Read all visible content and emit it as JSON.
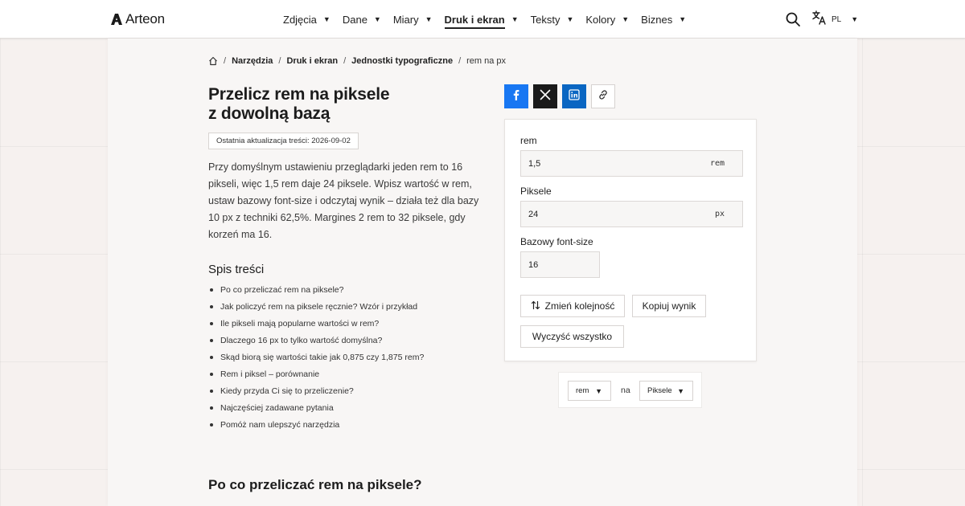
{
  "header": {
    "logo_text": "Arteon",
    "nav": [
      {
        "label": "Zdjęcia",
        "active": false
      },
      {
        "label": "Dane",
        "active": false
      },
      {
        "label": "Miary",
        "active": false
      },
      {
        "label": "Druk i ekran",
        "active": true
      },
      {
        "label": "Teksty",
        "active": false
      },
      {
        "label": "Kolory",
        "active": false
      },
      {
        "label": "Biznes",
        "active": false
      }
    ],
    "chevron": "▼",
    "language_code": "PL"
  },
  "breadcrumb": {
    "items": [
      "Narzędzia",
      "Druk i ekran",
      "Jednostki typograficzne"
    ],
    "current": "rem na px",
    "separator": "/"
  },
  "article": {
    "title_line1": "Przelicz rem na piksele",
    "title_line2": "z dowolną bazą",
    "updated": "Ostatnia aktualizacja treści: 2026-09-02",
    "intro": "Przy domyślnym ustawieniu przeglądarki jeden rem to 16 pikseli, więc 1,5 rem daje 24 piksele. Wpisz wartość w rem, ustaw bazowy font-size i odczytaj wynik – działa też dla bazy 10 px z techniki 62,5%. Margines 2 rem to 32 piksele, gdy korzeń ma 16.",
    "toc_title": "Spis treści",
    "toc": [
      "Po co przeliczać rem na piksele?",
      "Jak policzyć rem na piksele ręcznie? Wzór i przykład",
      "Ile pikseli mają popularne wartości w rem?",
      "Dlaczego 16 px to tylko wartość domyślna?",
      "Skąd biorą się wartości takie jak 0,875 czy 1,875 rem?",
      "Rem i piksel – porównanie",
      "Kiedy przyda Ci się to przeliczenie?",
      "Najczęściej zadawane pytania",
      "Pomóż nam ulepszyć narzędzia"
    ],
    "section_heading": "Po co przeliczać rem na piksele?"
  },
  "converter": {
    "rem_label": "rem",
    "rem_value": "1,5",
    "rem_unit": "rem",
    "px_label": "Piksele",
    "px_value": "24",
    "px_unit": "px",
    "base_label": "Bazowy font-size",
    "base_value": "16",
    "swap_label": "Zmień kolejność",
    "copy_label": "Kopiuj wynik",
    "clear_label": "Wyczyść wszystko"
  },
  "unit_selector": {
    "from": "rem",
    "connector": "na",
    "to": "Piksele"
  },
  "colors": {
    "facebook": "#1877f2",
    "x": "#1a1a1a",
    "linkedin": "#0a66c2",
    "page_bg": "#f6f1ef",
    "panel_bg": "#f8f6f5"
  },
  "icons": [
    "home-icon",
    "search-icon",
    "translate-icon",
    "facebook-icon",
    "x-icon",
    "linkedin-icon",
    "link-icon",
    "swap-icon",
    "chevron-down-icon"
  ]
}
